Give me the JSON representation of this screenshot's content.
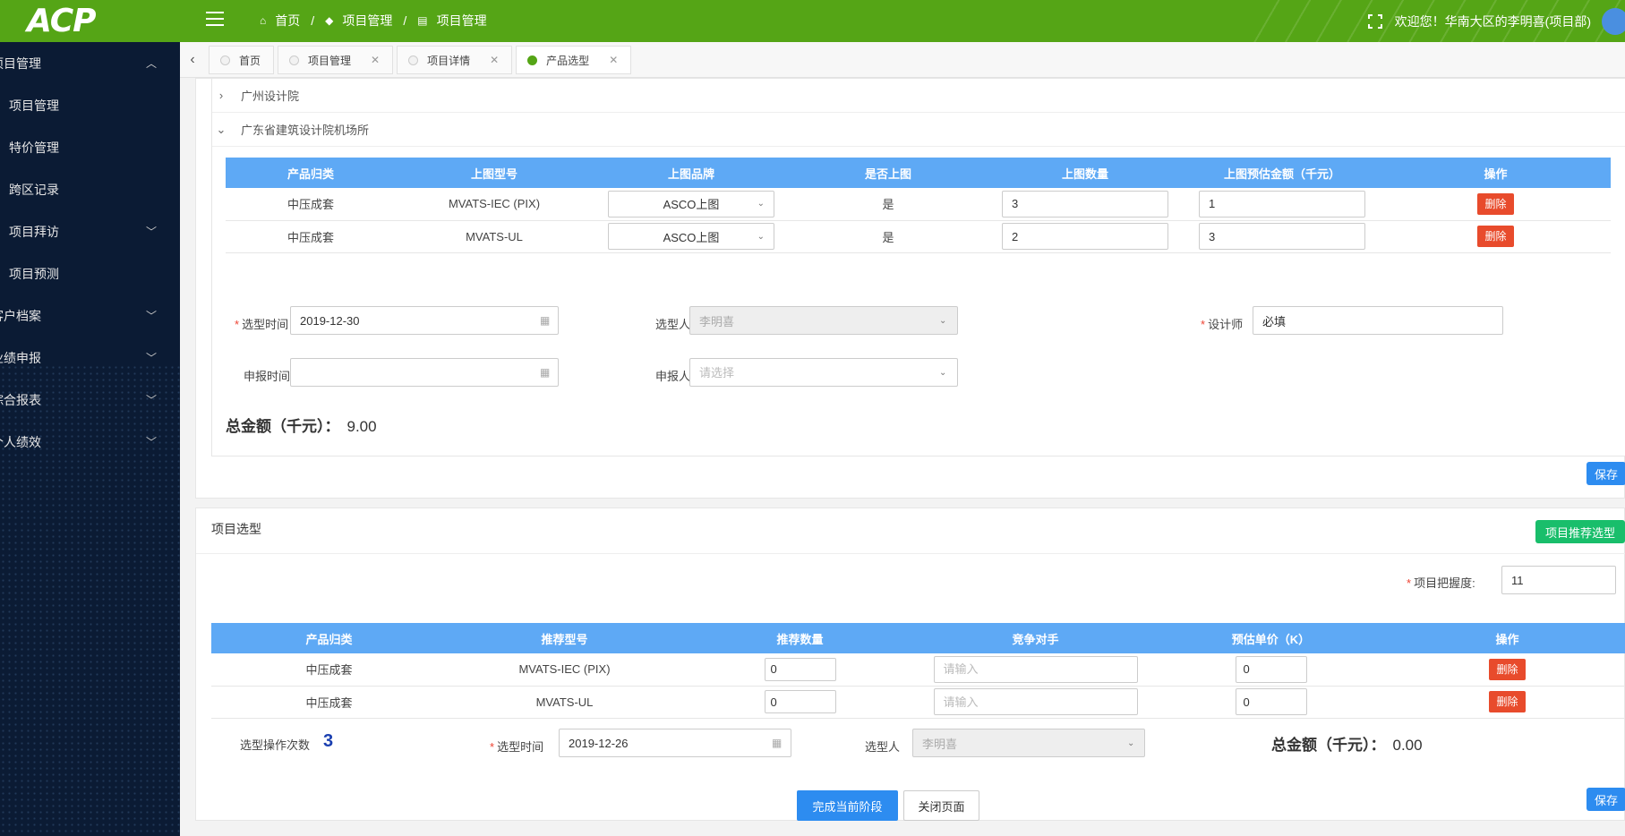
{
  "header": {
    "logo_text": "ACP",
    "breadcrumbs": [
      "首页",
      "项目管理",
      "项目管理"
    ],
    "welcome": "欢迎您！华南大区的李明喜(项目部)"
  },
  "sidebar": {
    "items": [
      {
        "label": "项目管理",
        "type": "group",
        "chevron": "up"
      },
      {
        "label": "项目管理",
        "type": "sub"
      },
      {
        "label": "特价管理",
        "type": "sub"
      },
      {
        "label": "跨区记录",
        "type": "sub"
      },
      {
        "label": "项目拜访",
        "type": "sub",
        "chevron": "down"
      },
      {
        "label": "项目预测",
        "type": "sub"
      },
      {
        "label": "客户档案",
        "type": "group",
        "chevron": "down"
      },
      {
        "label": "业绩申报",
        "type": "group",
        "chevron": "down"
      },
      {
        "label": "综合报表",
        "type": "group",
        "chevron": "down"
      },
      {
        "label": "个人绩效",
        "type": "group",
        "chevron": "down"
      }
    ]
  },
  "tabs": [
    {
      "label": "首页",
      "closable": false,
      "active": false
    },
    {
      "label": "项目管理",
      "closable": true,
      "active": false
    },
    {
      "label": "项目详情",
      "closable": true,
      "active": false
    },
    {
      "label": "产品选型",
      "closable": true,
      "active": true
    }
  ],
  "design_section": {
    "collapsed_item": "广州设计院",
    "expanded_item": "广东省建筑设计院机场所",
    "table": {
      "headers": [
        "产品归类",
        "上图型号",
        "上图品牌",
        "是否上图",
        "上图数量",
        "上图预估金额（千元）",
        "操作"
      ],
      "rows": [
        {
          "category": "中压成套",
          "model": "MVATS-IEC (PIX)",
          "brand": "ASCO上图",
          "on_drawing": "是",
          "qty": "3",
          "amount": "1",
          "action": "删除"
        },
        {
          "category": "中压成套",
          "model": "MVATS-UL",
          "brand": "ASCO上图",
          "on_drawing": "是",
          "qty": "2",
          "amount": "3",
          "action": "删除"
        }
      ]
    },
    "form": {
      "select_time_label": "选型时间",
      "select_time_value": "2019-12-30",
      "selector_label": "选型人",
      "selector_value": "李明喜",
      "designer_label": "设计师",
      "designer_value": "必填",
      "report_time_label": "申报时间",
      "report_time_value": "",
      "reporter_label": "申报人",
      "reporter_placeholder": "请选择"
    },
    "total_label": "总金额（千元）：",
    "total_value": "9.00",
    "save_label": "保存"
  },
  "project_section": {
    "title": "项目选型",
    "recommend_button": "项目推荐选型",
    "confidence_label": "项目把握度:",
    "confidence_value": "11",
    "table": {
      "headers": [
        "产品归类",
        "推荐型号",
        "推荐数量",
        "竞争对手",
        "预估单价（K）",
        "操作"
      ],
      "rows": [
        {
          "category": "中压成套",
          "model": "MVATS-IEC (PIX)",
          "qty": "0",
          "competitor_placeholder": "请输入",
          "price": "0",
          "action": "删除"
        },
        {
          "category": "中压成套",
          "model": "MVATS-UL",
          "qty": "0",
          "competitor_placeholder": "请输入",
          "price": "0",
          "action": "删除"
        }
      ]
    },
    "op_count_label": "选型操作次数",
    "op_count_value": "3",
    "select_time_label": "选型时间",
    "select_time_value": "2019-12-26",
    "selector_label": "选型人",
    "selector_value": "李明喜",
    "total_label": "总金额（千元）：",
    "total_value": "0.00",
    "save_label": "保存"
  },
  "footer": {
    "complete_button": "完成当前阶段",
    "close_button": "关闭页面"
  },
  "colors": {
    "header_green": "#55a516",
    "sidebar_bg": "#0b1b34",
    "table_header_blue": "#5ea9f5",
    "delete_red": "#e84b2c",
    "save_blue": "#2d8cf0",
    "recommend_green": "#19be6b"
  }
}
